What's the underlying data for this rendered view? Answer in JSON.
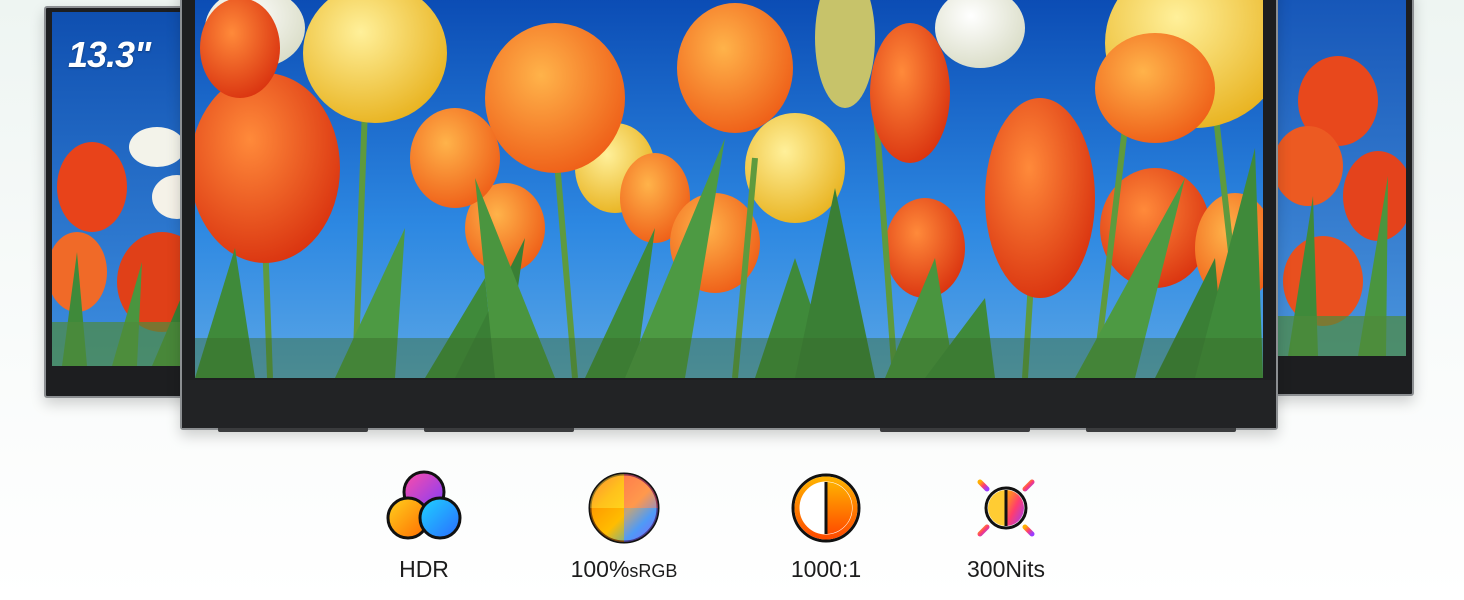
{
  "left_monitor": {
    "size_label": "13.3\""
  },
  "features": [
    {
      "label": "HDR",
      "icon": "hdr-icon"
    },
    {
      "label_main": "100%",
      "label_suffix": "sRGB",
      "icon": "color-wheel-icon"
    },
    {
      "label": "1000:1",
      "icon": "contrast-icon"
    },
    {
      "label": "300Nits",
      "icon": "brightness-icon"
    }
  ],
  "colors": {
    "bezel": "#1d1e20",
    "frame": "#8c8f92",
    "sky": "#1a6fd0",
    "tulip_red": "#e8431a",
    "tulip_orange": "#f57a1f",
    "tulip_yellow": "#f5cd3a",
    "leaf_green": "#3f8a3a"
  }
}
